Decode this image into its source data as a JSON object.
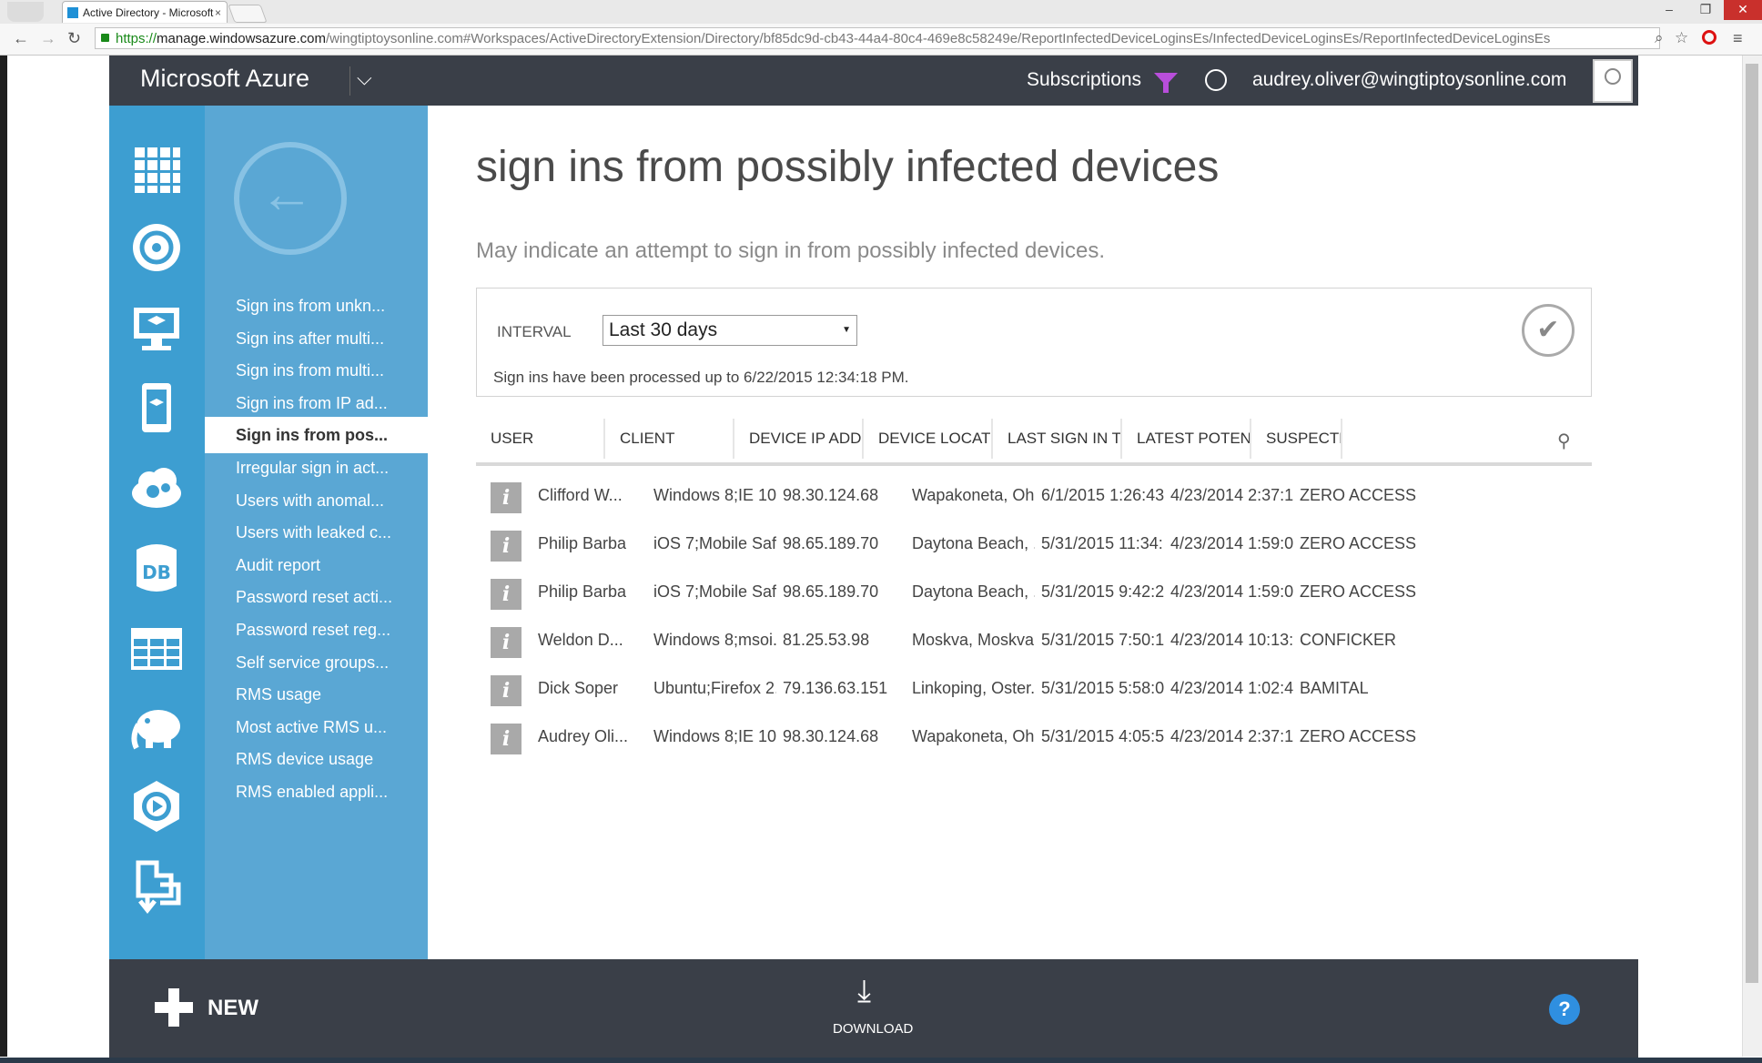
{
  "browser": {
    "tab_title": "Active Directory - Microsoft",
    "tab_close": "×",
    "url_scheme": "https://",
    "url_host": "manage.windowsazure.com",
    "url_rest": "/wingtiptoysonline.com#Workspaces/ActiveDirectoryExtension/Directory/bf85dc9d-cb43-44a4-80c4-469e8c58249e/ReportInfectedDeviceLoginsEs/InfectedDeviceLoginsEs/ReportInfectedDeviceLoginsEs",
    "controls": {
      "minimize": "–",
      "maximize": "❐",
      "close": "✕"
    },
    "nav": {
      "back": "←",
      "forward": "→",
      "reload": "↻"
    },
    "url_icons": {
      "search": "⌕",
      "star": "☆"
    },
    "menu_icon": "≡"
  },
  "header": {
    "brand": "Microsoft Azure",
    "brand_chevron": "⌵",
    "subscriptions": "Subscriptions",
    "user_email": "audrey.oliver@wingtiptoysonline.com"
  },
  "rail_icons": [
    "grid-icon",
    "globe-network-icon",
    "virtual-machine-icon",
    "mobile-service-icon",
    "cloud-service-icon",
    "database-icon",
    "table-storage-icon",
    "hdinsight-elephant-icon",
    "media-services-icon",
    "import-export-icon"
  ],
  "sidebar": {
    "items": [
      {
        "label": "Sign ins from unkn..."
      },
      {
        "label": "Sign ins after multi..."
      },
      {
        "label": "Sign ins from multi..."
      },
      {
        "label": "Sign ins from IP ad..."
      },
      {
        "label": "Sign ins from pos..."
      },
      {
        "label": "Irregular sign in act..."
      },
      {
        "label": "Users with anomal..."
      },
      {
        "label": "Users with leaked c..."
      },
      {
        "label": "Audit report"
      },
      {
        "label": "Password reset acti..."
      },
      {
        "label": "Password reset reg..."
      },
      {
        "label": "Self service groups..."
      },
      {
        "label": "RMS usage"
      },
      {
        "label": "Most active RMS u..."
      },
      {
        "label": "RMS device usage"
      },
      {
        "label": "RMS enabled appli..."
      }
    ],
    "active_index": 4
  },
  "main": {
    "title": "sign ins from possibly infected devices",
    "subtitle": "May indicate an attempt to sign in from possibly infected devices.",
    "interval_label": "INTERVAL",
    "interval_value": "Last 30 days",
    "processed_text": "Sign ins have been processed up to 6/22/2015 12:34:18 PM."
  },
  "table": {
    "columns": [
      "USER",
      "CLIENT",
      "DEVICE IP ADD...",
      "DEVICE LOCATI...",
      "LAST SIGN IN TI...",
      "LATEST POTEN...",
      "SUSPECTE..."
    ],
    "rows": [
      [
        "Clifford W...",
        "Windows 8;IE 10.0",
        "98.30.124.68",
        "Wapakoneta, Oh...",
        "6/1/2015 1:26:43...",
        "4/23/2014 2:37:1...",
        "ZERO ACCESS"
      ],
      [
        "Philip Barba",
        "iOS 7;Mobile Saf...",
        "98.65.189.70",
        "Daytona Beach, ...",
        "5/31/2015 11:34:...",
        "4/23/2014 1:59:0...",
        "ZERO ACCESS"
      ],
      [
        "Philip Barba",
        "iOS 7;Mobile Saf...",
        "98.65.189.70",
        "Daytona Beach, ...",
        "5/31/2015 9:42:2...",
        "4/23/2014 1:59:0...",
        "ZERO ACCESS"
      ],
      [
        "Weldon D...",
        "Windows 8;msoi...",
        "81.25.53.98",
        "Moskva, Moskva...",
        "5/31/2015 7:50:1...",
        "4/23/2014 10:13:...",
        "CONFICKER"
      ],
      [
        "Dick Soper",
        "Ubuntu;Firefox 2...",
        "79.136.63.151",
        "Linkoping, Oster...",
        "5/31/2015 5:58:0...",
        "4/23/2014 1:02:4...",
        "BAMITAL"
      ],
      [
        "Audrey Oli...",
        "Windows 8;IE 10.0",
        "98.30.124.68",
        "Wapakoneta, Oh...",
        "5/31/2015 4:05:5...",
        "4/23/2014 2:37:1...",
        "ZERO ACCESS"
      ]
    ],
    "info_glyph": "i"
  },
  "commandbar": {
    "new_label": "NEW",
    "download_label": "DOWNLOAD",
    "download_glyph": "⤓",
    "help_glyph": "?"
  },
  "colors": {
    "header": "#3a3f48",
    "rail": "#3d9ed1",
    "secnav": "#5aa7d4",
    "filter": "#b84edb",
    "help": "#2f8fe0"
  }
}
